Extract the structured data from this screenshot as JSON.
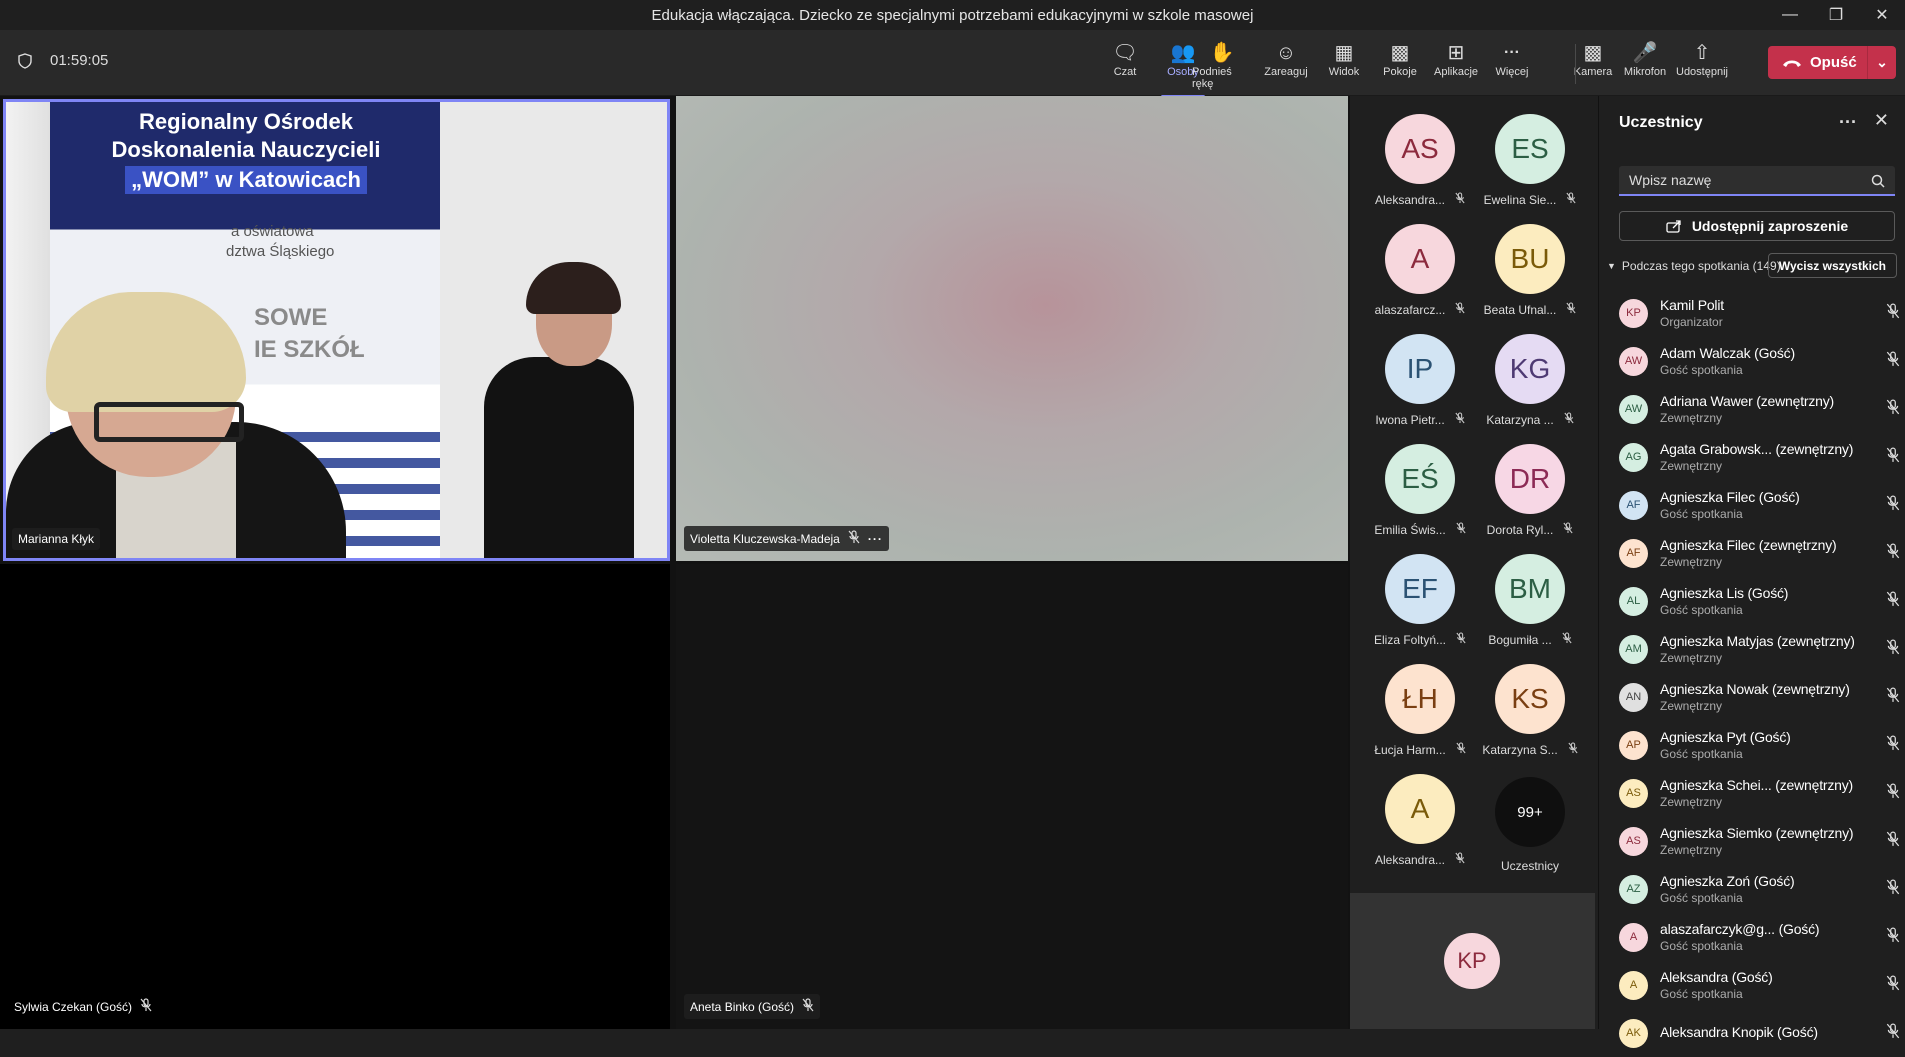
{
  "window": {
    "title": "Edukacja włączająca. Dziecko ze specjalnymi potrzebami edukacyjnymi w szkole masowej"
  },
  "toolbar": {
    "timer": "01:59:05",
    "buttons": [
      {
        "label": "Czat",
        "icon": "chat-icon"
      },
      {
        "label": "Osoby",
        "icon": "people-icon",
        "active": true
      },
      {
        "label": "Podnieś rękę",
        "icon": "hand-icon"
      },
      {
        "label": "Zareaguj",
        "icon": "react-icon"
      },
      {
        "label": "Widok",
        "icon": "grid-icon"
      },
      {
        "label": "Pokoje",
        "icon": "rooms-icon"
      },
      {
        "label": "Aplikacje",
        "icon": "apps-icon"
      },
      {
        "label": "Więcej",
        "icon": "more-icon"
      },
      {
        "label": "Kamera",
        "icon": "camera-off-icon"
      },
      {
        "label": "Mikrofon",
        "icon": "mic-off-icon"
      },
      {
        "label": "Udostępnij",
        "icon": "share-icon"
      }
    ],
    "leave_label": "Opuść"
  },
  "stage": {
    "tiles": [
      {
        "name": "Marianna Kłyk",
        "banner_lines": [
          "Regionalny Ośrodek",
          "Doskonalenia Nauczycieli",
          "„WOM” w Katowicach",
          "a oświatowa",
          "dztwa Śląskiego",
          "SOWE",
          "IE SZKÓŁ"
        ]
      },
      {
        "name": "Violetta Kluczewska-Madeja"
      },
      {
        "name": "Sylwia Czekan (Gość)"
      },
      {
        "name": "Aneta Binko (Gość)"
      }
    ]
  },
  "roster": {
    "people": [
      {
        "initials": "AS",
        "name": "Aleksandra...",
        "bg": "#f7d7dd",
        "fg": "#8c2a3d"
      },
      {
        "initials": "ES",
        "name": "Ewelina Sie...",
        "bg": "#d5eee1",
        "fg": "#2c5e44"
      },
      {
        "initials": "A",
        "name": "alaszafarcz...",
        "bg": "#f7d7dd",
        "fg": "#8c2a3d"
      },
      {
        "initials": "BU",
        "name": "Beata Ufnal...",
        "bg": "#fcecbf",
        "fg": "#7a5a09"
      },
      {
        "initials": "IP",
        "name": "Iwona Pietr...",
        "bg": "#d2e4f3",
        "fg": "#2b5273"
      },
      {
        "initials": "KG",
        "name": "Katarzyna ...",
        "bg": "#e5dbf3",
        "fg": "#4e3a73"
      },
      {
        "initials": "EŚ",
        "name": "Emilia Świs...",
        "bg": "#d5eee1",
        "fg": "#2c5e44"
      },
      {
        "initials": "DR",
        "name": "Dorota Ryl...",
        "bg": "#f7d7e5",
        "fg": "#8c2a55"
      },
      {
        "initials": "EF",
        "name": "Eliza Foltyń...",
        "bg": "#d2e4f3",
        "fg": "#2b5273"
      },
      {
        "initials": "BM",
        "name": "Bogumiła ...",
        "bg": "#d5eee1",
        "fg": "#2c5e44"
      },
      {
        "initials": "ŁH",
        "name": "Łucja Harm...",
        "bg": "#fde3cf",
        "fg": "#7a3f12"
      },
      {
        "initials": "KS",
        "name": "Katarzyna S...",
        "bg": "#fde3cf",
        "fg": "#7a3f12"
      },
      {
        "initials": "A",
        "name": "Aleksandra...",
        "bg": "#fcecbf",
        "fg": "#7a5a09"
      }
    ],
    "overflow": {
      "count": "99+",
      "label": "Uczestnicy"
    },
    "self_initials": "KP"
  },
  "panel": {
    "title": "Uczestnicy",
    "search_placeholder": "Wpisz nazwę",
    "invite_label": "Udostępnij zaproszenie",
    "section_label": "Podczas tego spotkania (149)",
    "mute_all_label": "Wycisz wszystkich",
    "participants": [
      {
        "initials": "KP",
        "name": "Kamil Polit",
        "role": "Organizator",
        "bg": "#f7d7dd",
        "fg": "#8c2a3d"
      },
      {
        "initials": "AW",
        "name": "Adam Walczak (Gość)",
        "role": "Gość spotkania",
        "bg": "#f7d7dd",
        "fg": "#8c2a3d"
      },
      {
        "initials": "AW",
        "name": "Adriana Wawer (zewnętrzny)",
        "role": "Zewnętrzny",
        "bg": "#d5eee1",
        "fg": "#2c5e44"
      },
      {
        "initials": "AG",
        "name": "Agata Grabowsk... (zewnętrzny)",
        "role": "Zewnętrzny",
        "bg": "#d5eee1",
        "fg": "#2c5e44"
      },
      {
        "initials": "AF",
        "name": "Agnieszka Filec (Gość)",
        "role": "Gość spotkania",
        "bg": "#d2e4f3",
        "fg": "#2b5273"
      },
      {
        "initials": "AF",
        "name": "Agnieszka Filec (zewnętrzny)",
        "role": "Zewnętrzny",
        "bg": "#fde3cf",
        "fg": "#7a3f12"
      },
      {
        "initials": "AL",
        "name": "Agnieszka Lis (Gość)",
        "role": "Gość spotkania",
        "bg": "#d5eee1",
        "fg": "#2c5e44"
      },
      {
        "initials": "AM",
        "name": "Agnieszka Matyjas (zewnętrzny)",
        "role": "Zewnętrzny",
        "bg": "#d5eee1",
        "fg": "#2c5e44"
      },
      {
        "initials": "AN",
        "name": "Agnieszka Nowak (zewnętrzny)",
        "role": "Zewnętrzny",
        "bg": "#e0e0e0",
        "fg": "#444444"
      },
      {
        "initials": "AP",
        "name": "Agnieszka Pyt (Gość)",
        "role": "Gość spotkania",
        "bg": "#fde3cf",
        "fg": "#7a3f12"
      },
      {
        "initials": "AS",
        "name": "Agnieszka Schei... (zewnętrzny)",
        "role": "Zewnętrzny",
        "bg": "#fcecbf",
        "fg": "#7a5a09"
      },
      {
        "initials": "AS",
        "name": "Agnieszka Siemko (zewnętrzny)",
        "role": "Zewnętrzny",
        "bg": "#f7d7dd",
        "fg": "#8c2a3d"
      },
      {
        "initials": "AZ",
        "name": "Agnieszka Zoń (Gość)",
        "role": "Gość spotkania",
        "bg": "#d5eee1",
        "fg": "#2c5e44"
      },
      {
        "initials": "A",
        "name": "alaszafarczyk@g... (Gość)",
        "role": "Gość spotkania",
        "bg": "#f7d7dd",
        "fg": "#8c2a3d"
      },
      {
        "initials": "A",
        "name": "Aleksandra (Gość)",
        "role": "Gość spotkania",
        "bg": "#fcecbf",
        "fg": "#7a5a09"
      },
      {
        "initials": "AK",
        "name": "Aleksandra Knopik (Gość)",
        "role": "",
        "bg": "#fcecbf",
        "fg": "#7a5a09"
      }
    ]
  },
  "colors": {
    "accent": "#7f85f5",
    "leave": "#c4314b",
    "active_speaker": "#7f85f5"
  }
}
